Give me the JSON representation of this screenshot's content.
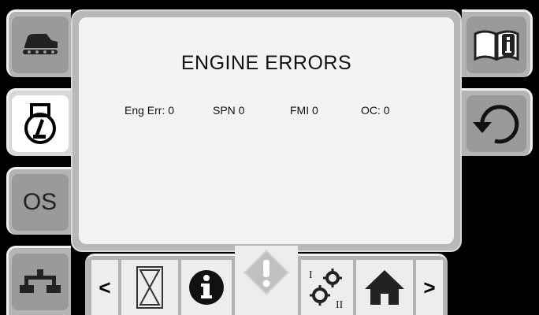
{
  "screen": {
    "title": "ENGINE ERRORS",
    "fields": {
      "eng_err": "Eng Err: 0",
      "spn": "SPN 0",
      "fmi": "FMI 0",
      "oc": "OC: 0"
    }
  },
  "left_tabs": {
    "os_label": "OS"
  },
  "bottom_nav": {
    "prev_label": "<",
    "next_label": ">"
  },
  "icons": {
    "left": [
      "vehicle-icon",
      "engine-gauge-icon",
      "os-icon",
      "hierarchy-icon"
    ],
    "right": [
      "manual-icon",
      "refresh-icon"
    ],
    "bottom": [
      "hourglass-icon",
      "info-icon",
      "warning-icon",
      "settings-gears-icon",
      "home-icon"
    ]
  }
}
